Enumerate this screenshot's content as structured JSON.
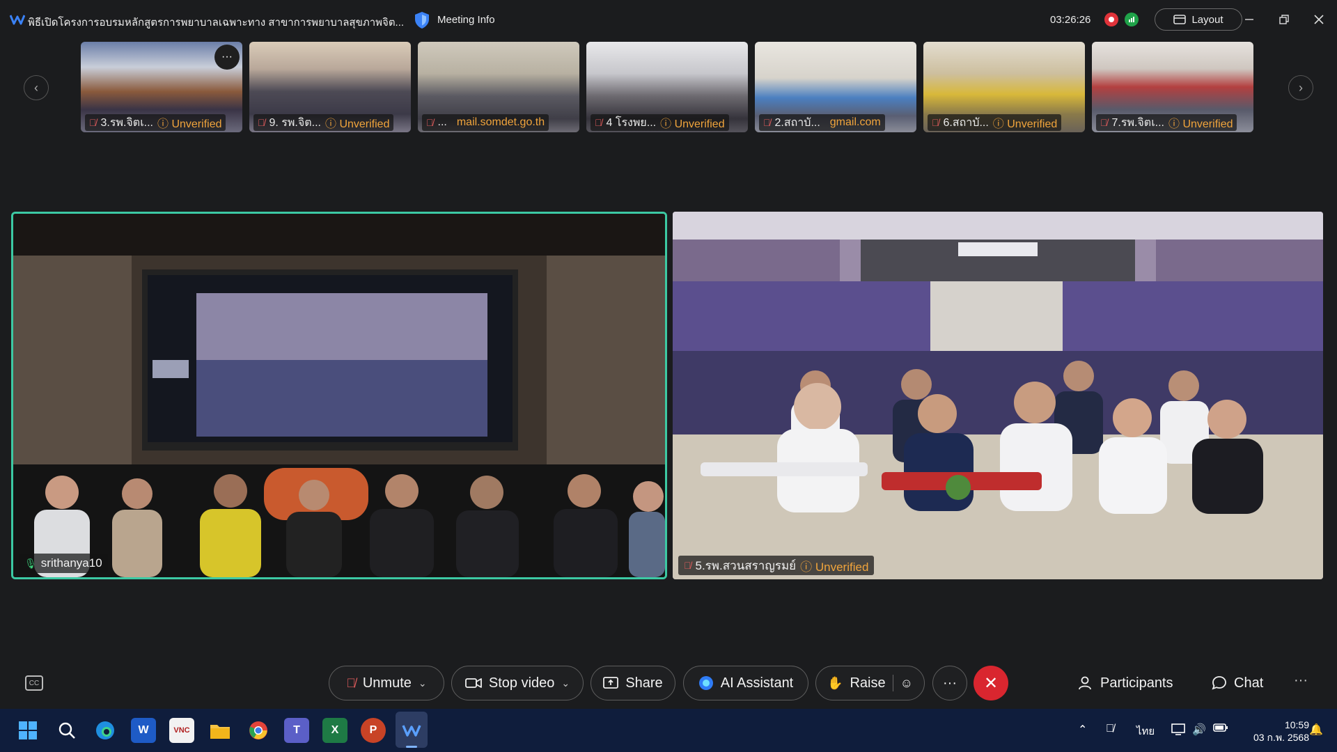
{
  "titlebar": {
    "title": "พิธีเปิดโครงการอบรมหลักสูตรการพยาบาลเฉพาะทาง สาขาการพยาบาลสุขภาพจิต...",
    "meeting_info": "Meeting Info",
    "timer": "03:26:26",
    "layout_label": "Layout"
  },
  "thumbnails": [
    {
      "name": "3.รพ.จิตเ...",
      "status": "Unverified",
      "mic": "muted"
    },
    {
      "name": "9. รพ.จิต...",
      "status": "Unverified",
      "mic": "muted"
    },
    {
      "name": "...",
      "status": "mail.somdet.go.th",
      "mic": "muted"
    },
    {
      "name": "4 โรงพย...",
      "status": "Unverified",
      "mic": "muted"
    },
    {
      "name": "2.สถาบั...",
      "status": "gmail.com",
      "mic": "muted"
    },
    {
      "name": "6.สถาบั...",
      "status": "Unverified",
      "mic": "muted"
    },
    {
      "name": "7.รพ.จิตเ...",
      "status": "Unverified",
      "mic": "muted"
    }
  ],
  "main_tiles": {
    "left": {
      "name": "srithanya10",
      "mic": "on"
    },
    "right": {
      "name": "5.รพ.สวนสราญรมย์",
      "status": "Unverified",
      "mic": "muted"
    }
  },
  "toolbar": {
    "unmute": "Unmute",
    "stop_video": "Stop video",
    "share": "Share",
    "ai_assistant": "AI Assistant",
    "raise": "Raise",
    "participants": "Participants",
    "chat": "Chat"
  },
  "taskbar": {
    "language": "ไทย",
    "time": "10:59",
    "date": "03 ก.พ. 2568"
  },
  "colors": {
    "accent_border": "#3cc9a3",
    "leave": "#d9262f",
    "unverified": "#f0a43c",
    "taskbar": "#0f1d3c"
  }
}
